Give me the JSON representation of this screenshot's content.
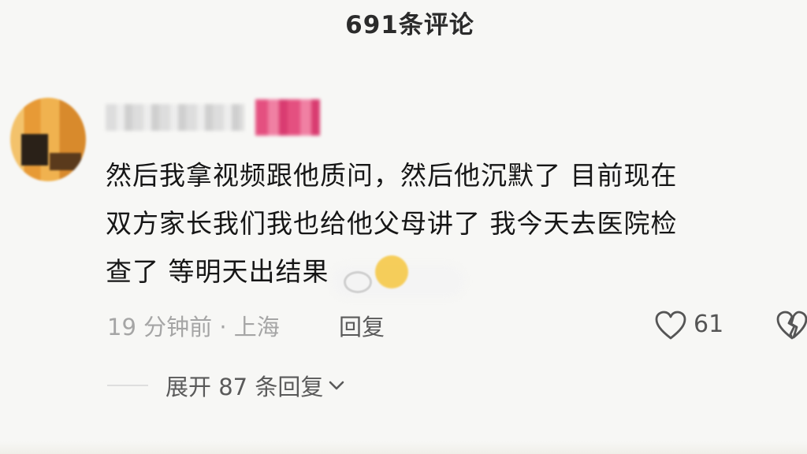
{
  "header": {
    "title": "691条评论"
  },
  "comment": {
    "text_lines": [
      "然后我拿视频跟他质问，然后他沉默了 目前现在",
      "双方家长我们我也给他父母讲了 我今天去医院检",
      "查了 等明天出结果"
    ],
    "time_location": "19 分钟前 · 上海",
    "reply_label": "回复",
    "like_count": "61",
    "expand_replies_label": "展开 87 条回复"
  },
  "icons": {
    "like": "heart-outline-icon",
    "dislike": "broken-heart-icon",
    "expand": "chevron-down-icon"
  },
  "colors": {
    "text": "#161616",
    "meta": "#a5a5a5",
    "action": "#5a5a5a",
    "background": "#f7f7f5"
  }
}
